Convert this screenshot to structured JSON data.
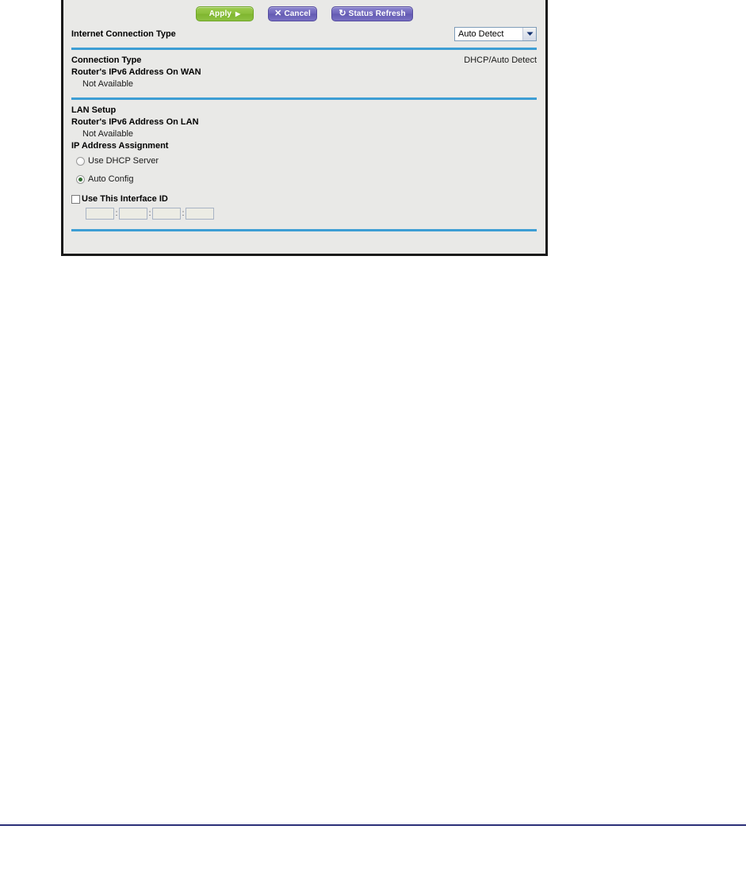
{
  "toolbar": {
    "apply_label": "Apply",
    "apply_arrow": "▶",
    "cancel_label": "Cancel",
    "cancel_glyph": "✕",
    "status_refresh_label": "Status Refresh",
    "status_refresh_glyph": "↻"
  },
  "internet_connection": {
    "label": "Internet Connection Type",
    "selected_option": "Auto Detect",
    "options": [
      "Auto Detect"
    ]
  },
  "wan_section": {
    "connection_type_label": "Connection Type",
    "connection_type_value": "DHCP/Auto Detect",
    "router_ipv6_wan_label": "Router's IPv6 Address On WAN",
    "router_ipv6_wan_value": "Not Available"
  },
  "lan_section": {
    "heading": "LAN Setup",
    "router_ipv6_lan_label": "Router's IPv6 Address On LAN",
    "router_ipv6_lan_value": "Not Available",
    "ip_assignment_label": "IP Address Assignment",
    "options": [
      {
        "label": "Use DHCP Server",
        "selected": false
      },
      {
        "label": "Auto Config",
        "selected": true
      }
    ],
    "interface_id": {
      "checkbox_label": "Use This Interface ID",
      "checked": false,
      "separator": ":",
      "fields": [
        {
          "value": ""
        },
        {
          "value": ""
        },
        {
          "value": ""
        },
        {
          "value": ""
        }
      ]
    }
  },
  "colors": {
    "divider_blue": "#3d9ed4",
    "apply_green": "#8cc03c",
    "button_purple": "#6f66bb",
    "panel_bg": "#e9e9e7",
    "page_rule_navy": "#2b2f78"
  }
}
